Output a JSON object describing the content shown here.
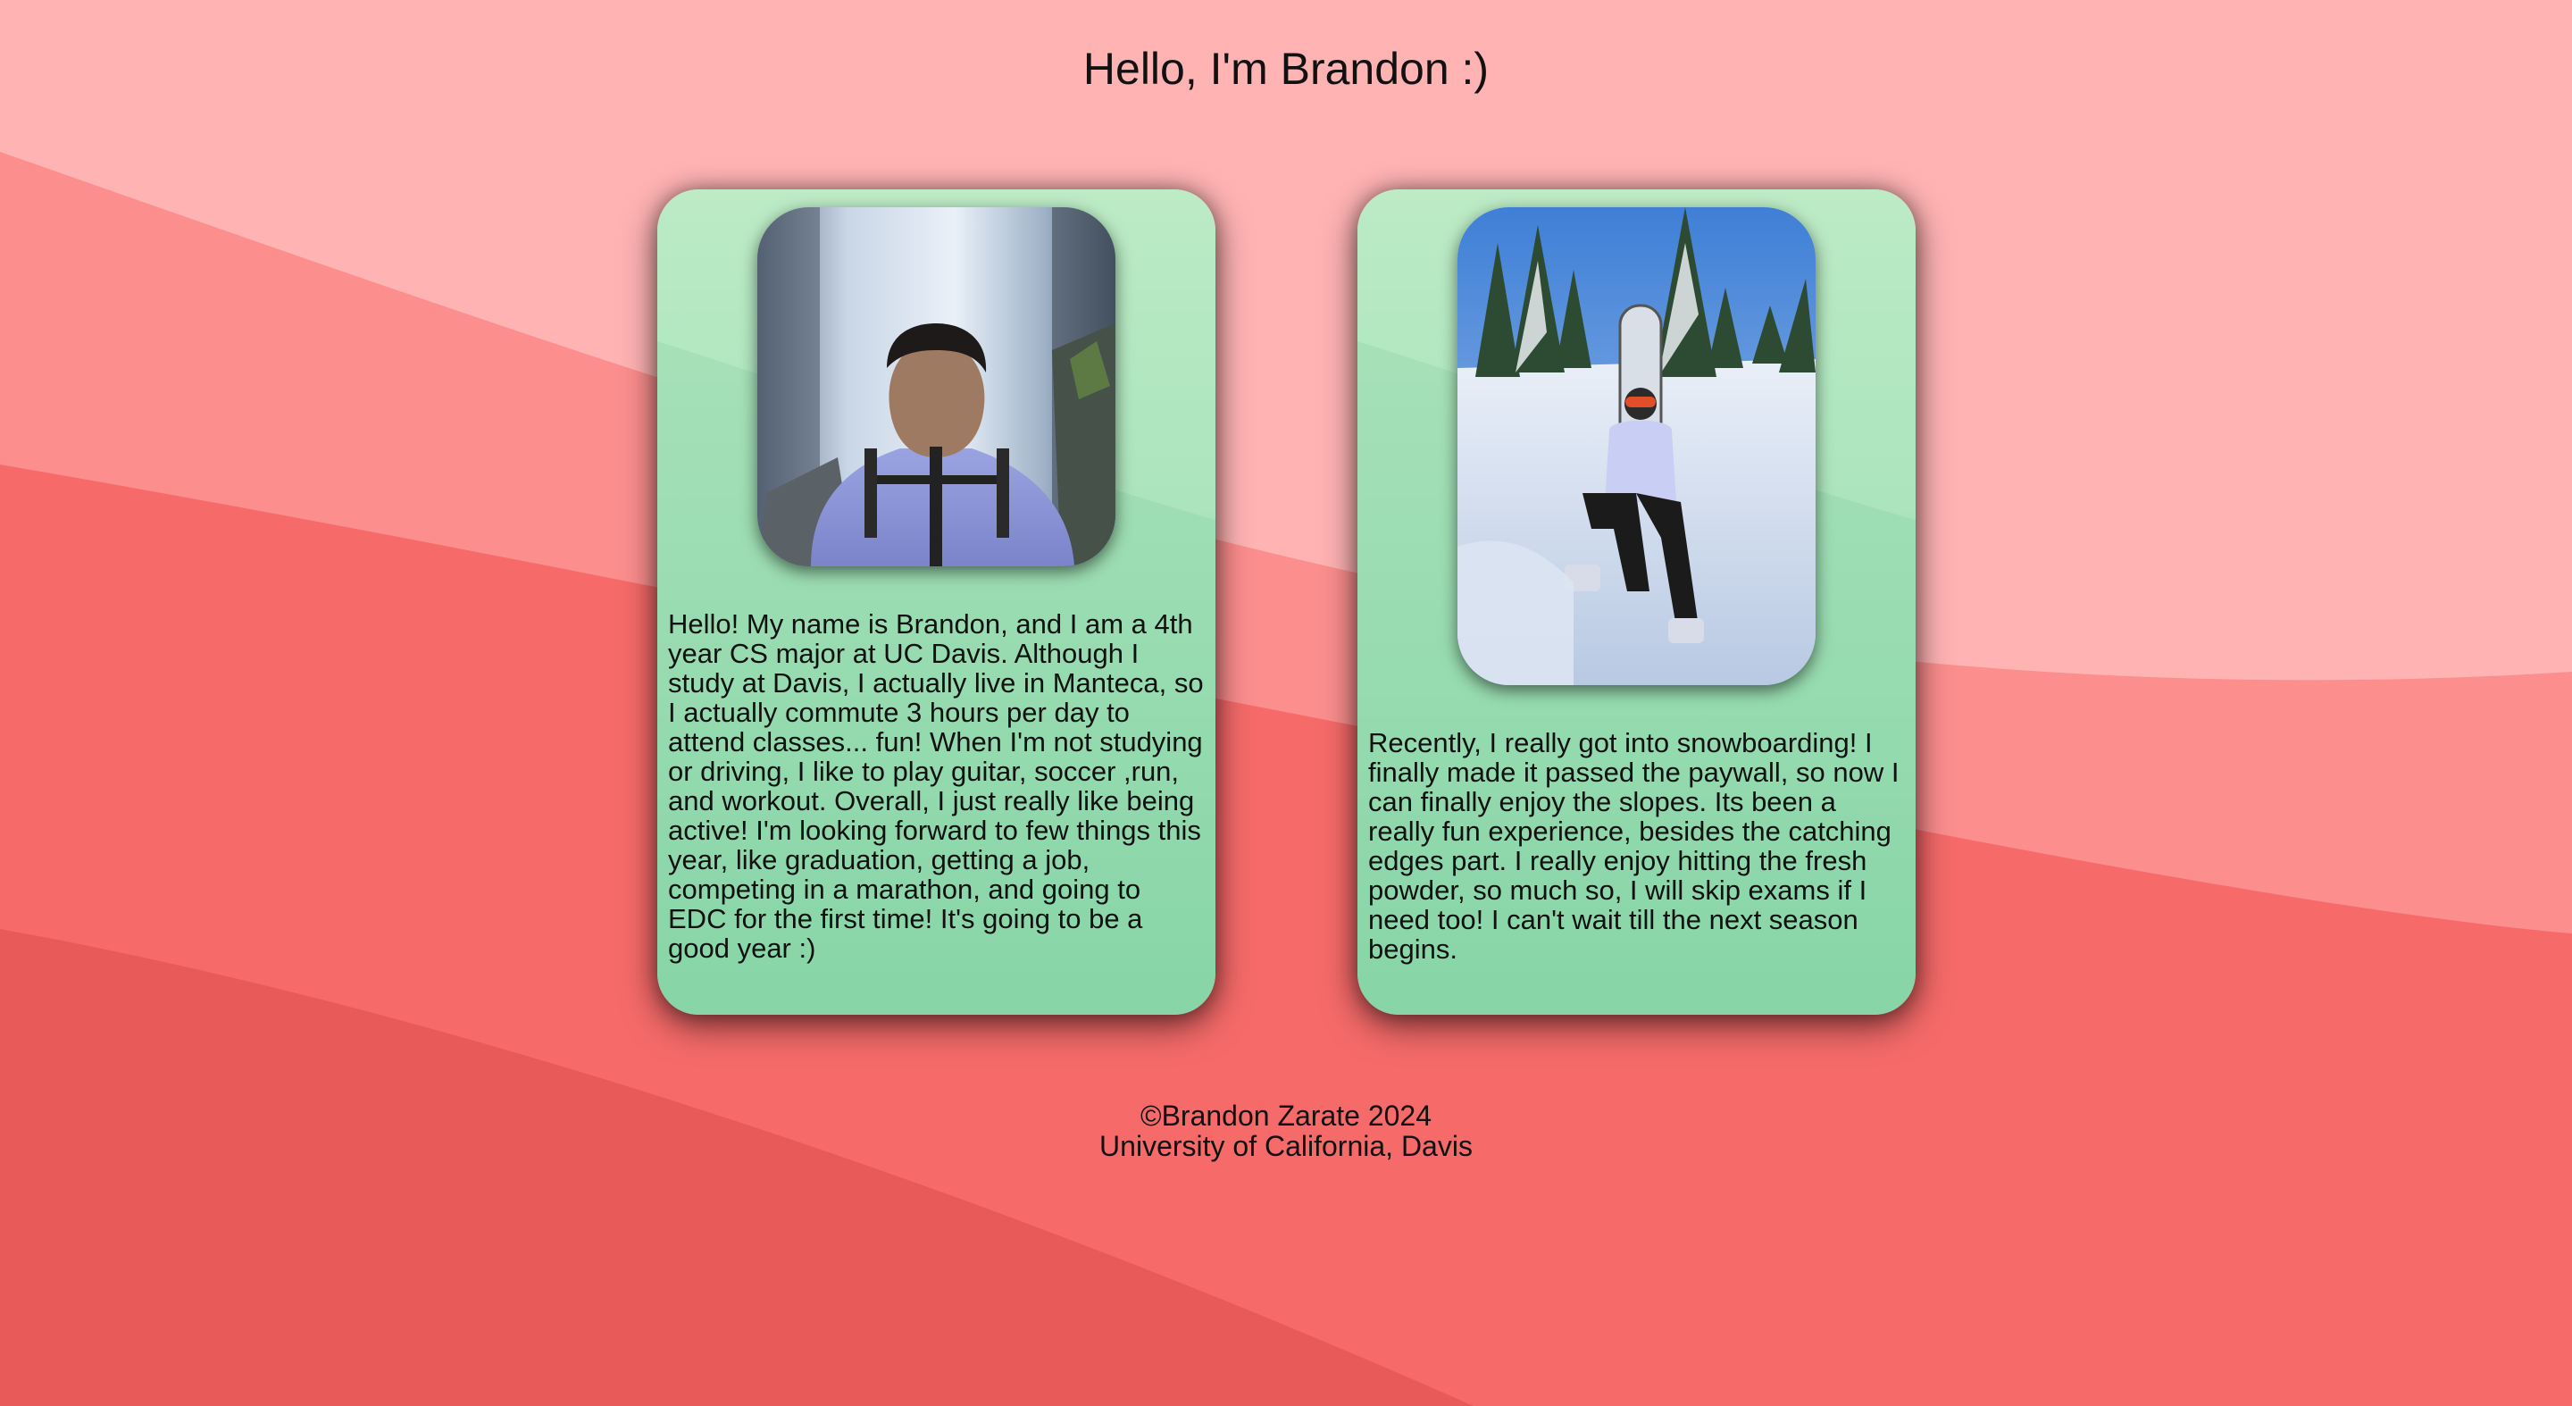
{
  "header": {
    "title": "Hello, I'm Brandon :)"
  },
  "cards": [
    {
      "photo_icon": "portrait-photo-waterfall",
      "text": "Hello! My name is Brandon, and I am a 4th year CS major at UC Davis. Although I study at Davis, I actually live in Manteca, so I actually commute 3 hours per day to attend classes... fun! When I'm not studying or driving, I like to play guitar, soccer ,run, and workout. Overall, I just really like being active! I'm looking forward to few things this year, like graduation, getting a job, competing in a marathon, and going to EDC for the first time! It's going to be a good year :)"
    },
    {
      "photo_icon": "snowboarding-photo",
      "text": "Recently, I really got into snowboarding! I finally made it passed the paywall, so now I can finally enjoy the slopes. Its been a really fun experience, besides the catching edges part. I really enjoy hitting the fresh powder, so much so, I will skip exams if I need too! I can't wait till the next season begins."
    }
  ],
  "footer": {
    "copyright": "©Brandon Zarate 2024",
    "school": "University of California, Davis"
  },
  "colors": {
    "bg_light": "#ffb3b3",
    "bg_mid": "#f98585",
    "bg_main": "#f66a6a",
    "bg_dark": "#e85a5a",
    "card_top": "#bcebc4",
    "card_bottom": "#8cd9ad"
  }
}
